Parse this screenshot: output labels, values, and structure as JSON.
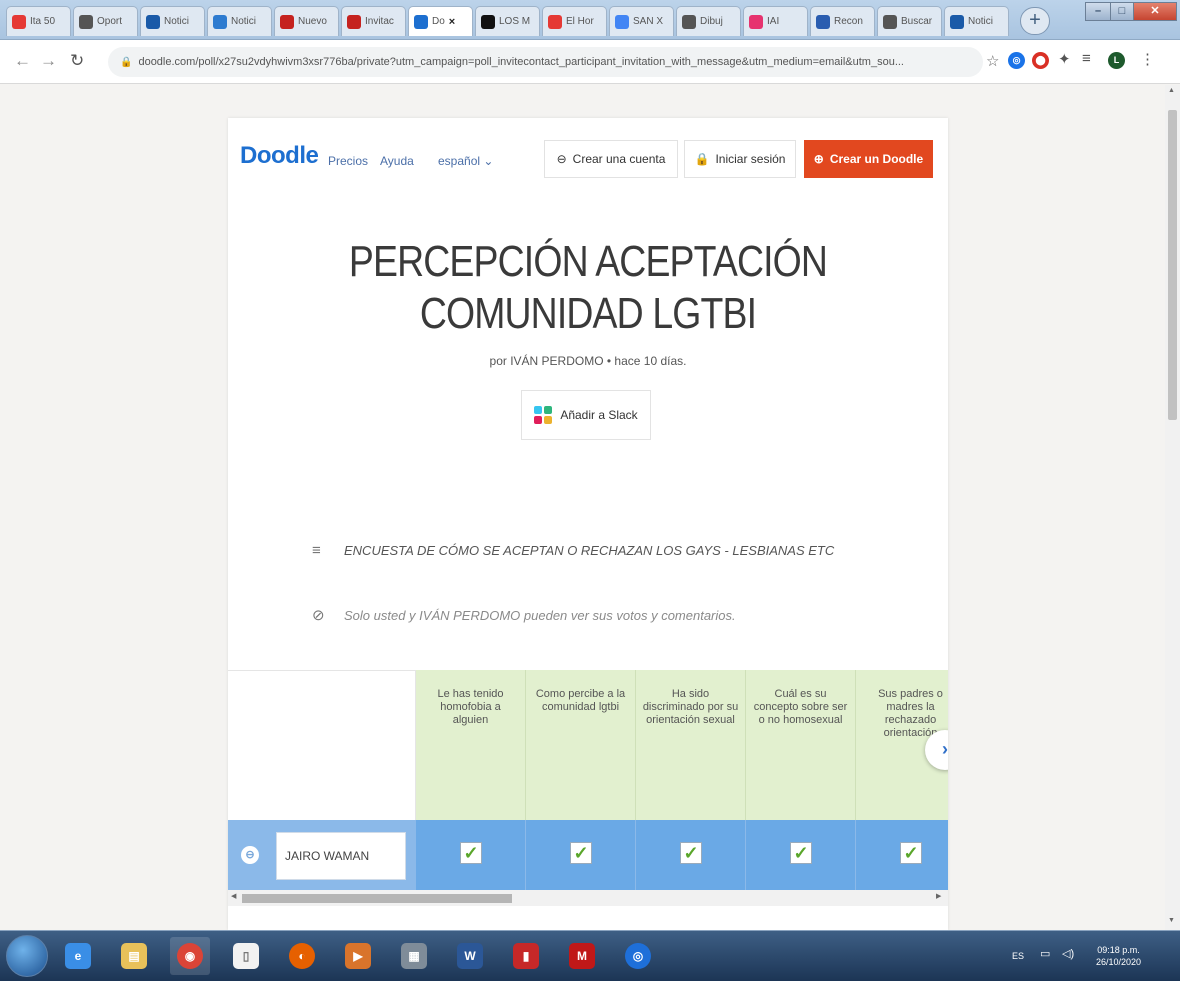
{
  "browser": {
    "tabs": [
      {
        "title": "Ita 50",
        "favicon_color": "#e53935",
        "icon": "youtube-icon"
      },
      {
        "title": "Oport",
        "favicon_color": "#555555",
        "icon": "chrome-icon"
      },
      {
        "title": "Notici",
        "favicon_color": "#1a5aa8",
        "icon": "et-icon"
      },
      {
        "title": "Notici",
        "favicon_color": "#2d7bd0",
        "icon": "news-icon"
      },
      {
        "title": "Nuevo",
        "favicon_color": "#c5221f",
        "icon": "gmail-icon"
      },
      {
        "title": "Invitac",
        "favicon_color": "#c5221f",
        "icon": "gmail-icon"
      },
      {
        "title": "Do",
        "favicon_color": "#1d6fd0",
        "icon": "doodle-icon",
        "active": true
      },
      {
        "title": "LOS M",
        "favicon_color": "#111111",
        "icon": "record-icon"
      },
      {
        "title": "El Hor",
        "favicon_color": "#e53935",
        "icon": "youtube-icon"
      },
      {
        "title": "SAN X",
        "favicon_color": "#4285f4",
        "icon": "google-icon"
      },
      {
        "title": "Dibuj",
        "favicon_color": "#555555",
        "icon": "chrome-icon"
      },
      {
        "title": "IAI",
        "favicon_color": "#e6336f",
        "icon": "app-icon"
      },
      {
        "title": "Recon",
        "favicon_color": "#2a5db0",
        "icon": "site-icon"
      },
      {
        "title": "Buscar",
        "favicon_color": "#555555",
        "icon": "chrome-icon"
      },
      {
        "title": "Notici",
        "favicon_color": "#1a5aa8",
        "icon": "et-icon"
      }
    ],
    "url": "doodle.com/poll/x27su2vdyhwivm3xsr776ba/private?utm_campaign=poll_invitecontact_participant_invitation_with_message&utm_medium=email&utm_sou..."
  },
  "header": {
    "logo": "Doodle",
    "nav": [
      "Precios",
      "Ayuda",
      "español"
    ],
    "create_account": "Crear una cuenta",
    "login": "Iniciar sesión",
    "create_doodle": "Crear un Doodle"
  },
  "poll": {
    "title_line1": "PERCEPCIÓN ACEPTACIÓN",
    "title_line2": "COMUNIDAD LGTBI",
    "meta": "por IVÁN PERDOMO • hace 10 días.",
    "slack_button": "Añadir a Slack",
    "description": "ENCUESTA DE CÓMO SE ACEPTAN O RECHAZAN LOS GAYS - LESBIANAS ETC",
    "privacy_note": "Solo usted y IVÁN PERDOMO pueden ver sus votos y comentarios."
  },
  "table": {
    "columns": [
      "Le has tenido homofobia a alguien",
      "Como percibe a la comunidad lgtbi",
      "Ha sido discriminado por su orientación sexual",
      "Cuál es su concepto sobre ser o no homosexual",
      "Sus padres o madres la rechazado orientación"
    ],
    "participant": "JAIRO WAMAN",
    "votes": [
      true,
      true,
      true,
      true,
      true
    ]
  },
  "taskbar": {
    "lang": "ES",
    "time": "09:18 p.m.",
    "date": "26/10/2020"
  },
  "colors": {
    "doodle_blue": "#1d6fd0",
    "doodle_red": "#e2481f",
    "option_green": "#e2f0cf",
    "participant_blue": "#6aa9e6"
  }
}
